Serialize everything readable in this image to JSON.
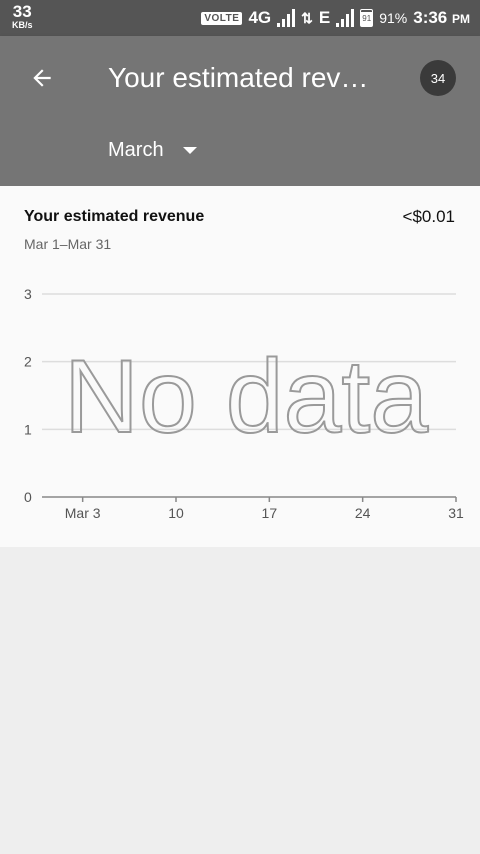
{
  "status_bar": {
    "speed_value": "33",
    "speed_unit": "KB/s",
    "volte": "VOLTE",
    "network_1": "4G",
    "network_2": "E",
    "battery_level": "91",
    "battery_percent": "91%",
    "time": "3:36",
    "ampm": "PM"
  },
  "app_bar": {
    "title": "Your estimated rev…",
    "badge_count": "34",
    "month_selector": "March"
  },
  "card": {
    "title": "Your estimated revenue",
    "value": "<$0.01",
    "date_range": "Mar 1–Mar 31",
    "empty_message": "No data"
  },
  "chart_data": {
    "type": "line",
    "y_ticks": [
      "3",
      "2",
      "1",
      "0"
    ],
    "x_ticks": [
      "Mar 3",
      "10",
      "17",
      "24",
      "31"
    ],
    "ylim": [
      0,
      3
    ],
    "grid": true,
    "series": []
  }
}
